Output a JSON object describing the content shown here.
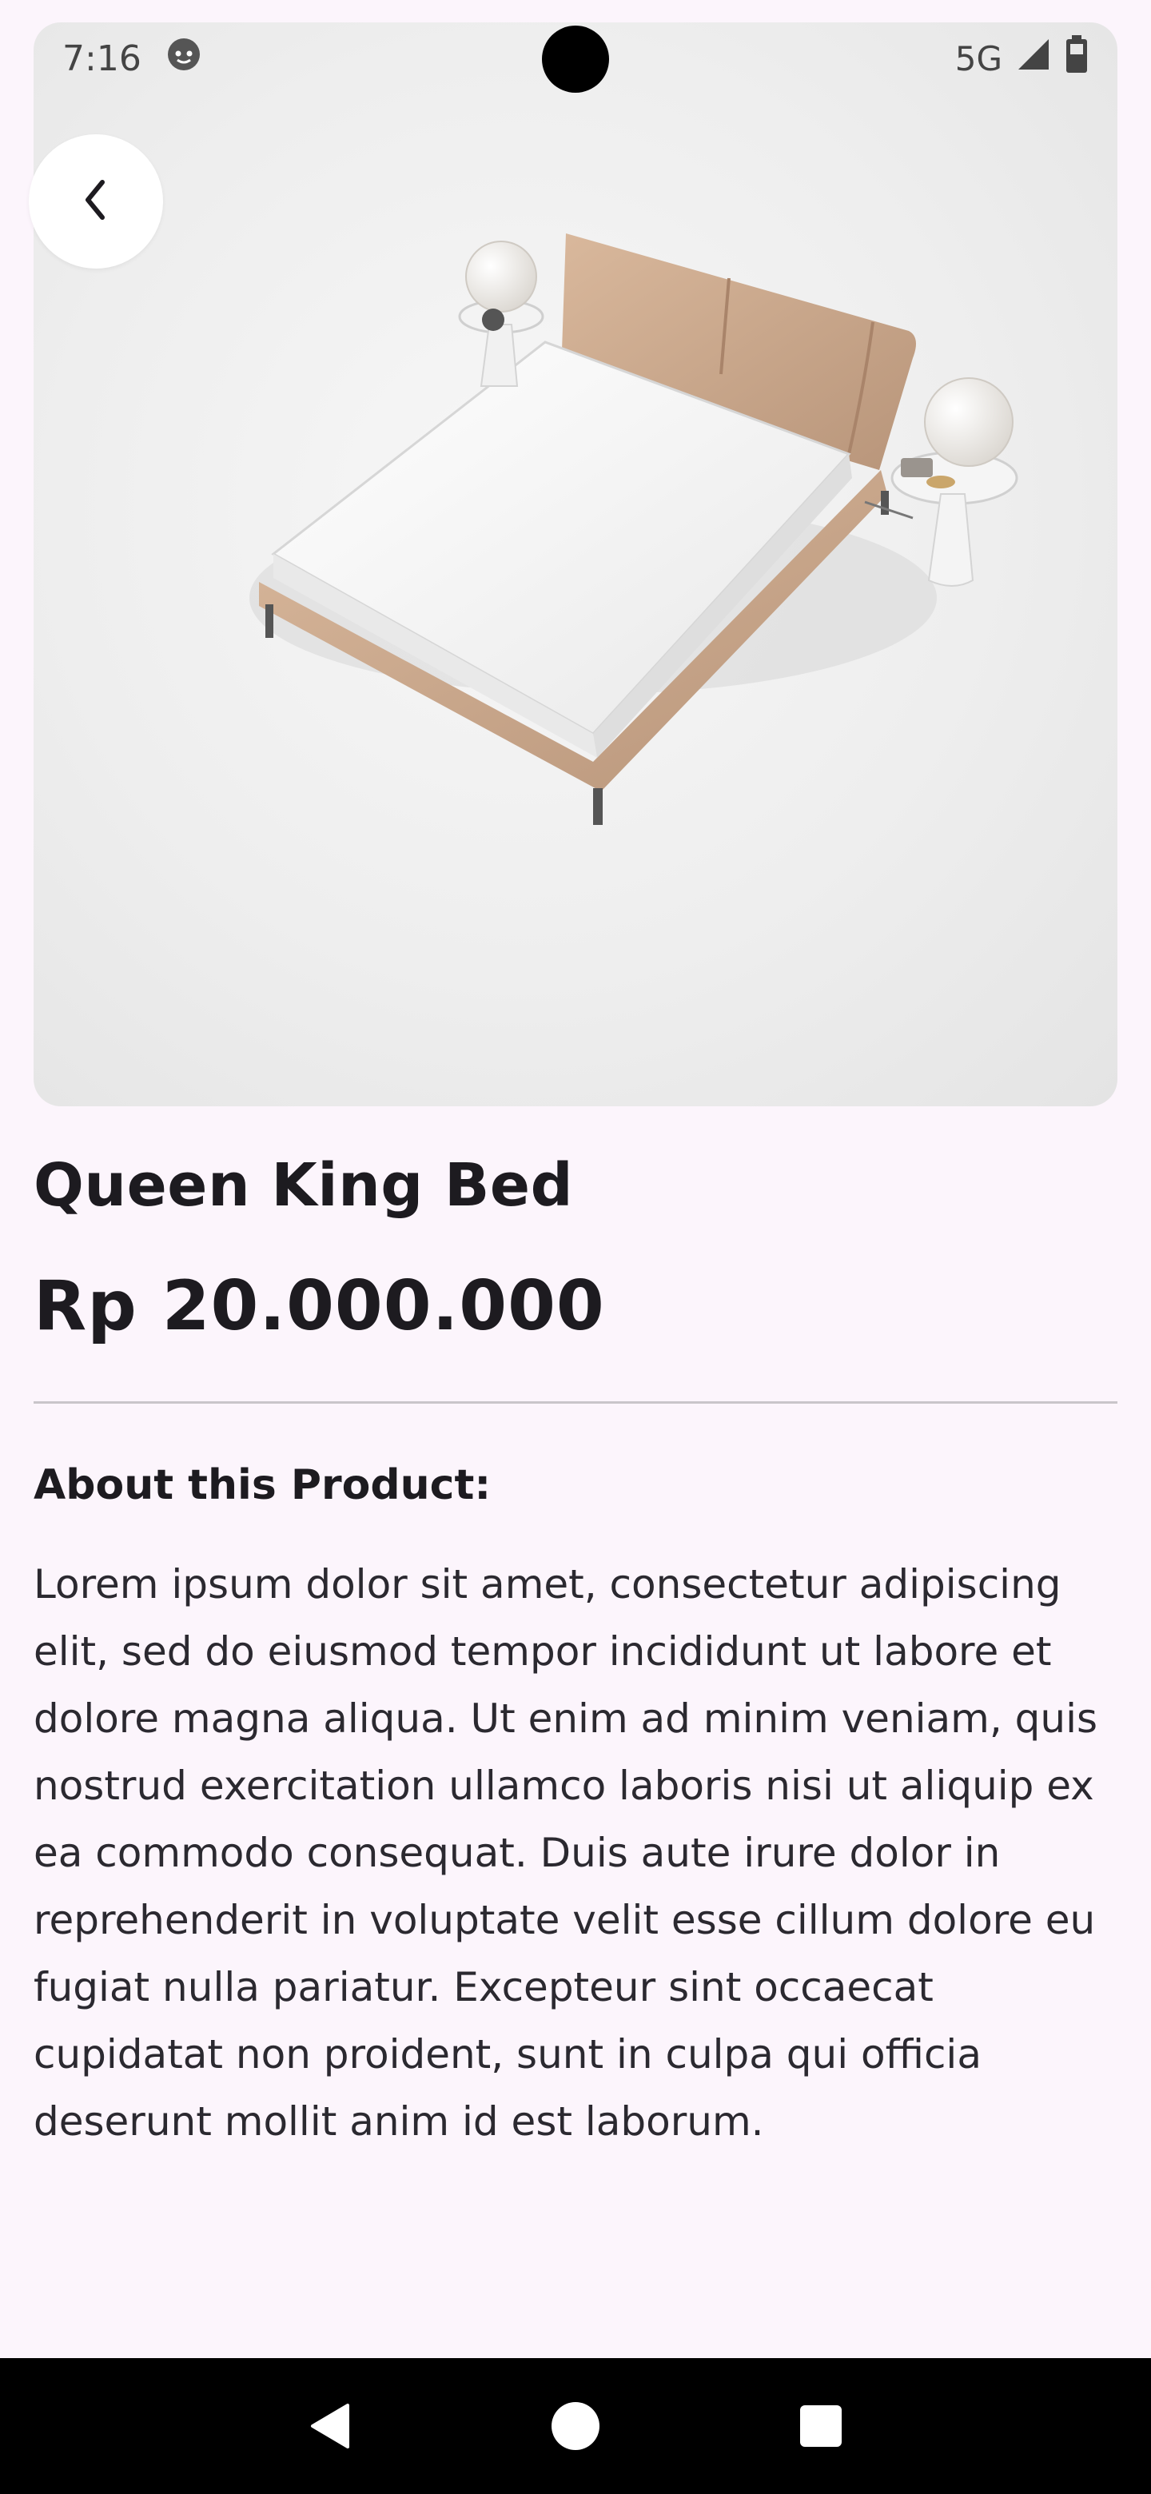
{
  "status_bar": {
    "time": "7:16",
    "network": "5G",
    "notification_icon": "face-icon",
    "signal_icon": "signal-icon",
    "battery_icon": "battery-icon"
  },
  "product": {
    "image_icon": "bed-product-image",
    "name": "Queen King Bed",
    "price": "Rp 20.000.000",
    "about_heading": "About this Product:",
    "description": "Lorem ipsum dolor sit amet, consectetur adipiscing elit, sed do eiusmod tempor incididunt ut labore et dolore magna aliqua. Ut enim ad minim veniam, quis nostrud exercitation ullamco laboris nisi ut aliquip ex ea commodo consequat. Duis aute irure dolor in reprehenderit in voluptate velit esse cillum dolore eu fugiat nulla pariatur. Excepteur sint occaecat cupidatat non proident, sunt in culpa qui officia deserunt mollit anim id est laborum."
  },
  "colors": {
    "background": "#fcf5fc",
    "text": "#1d1b20",
    "divider": "#c9c5ca",
    "nav_bar": "#000000"
  },
  "nav": {
    "back_icon": "back-triangle-icon",
    "home_icon": "home-circle-icon",
    "recents_icon": "recents-square-icon"
  }
}
